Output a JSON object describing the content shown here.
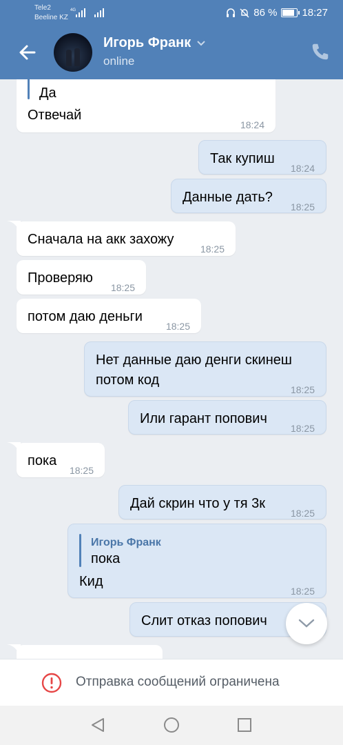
{
  "status": {
    "carrier1": "Tele2",
    "carrier2": "Beeline KZ",
    "network": "4G",
    "battery": "86 %",
    "clock": "18:27"
  },
  "header": {
    "name": "Игорь Франк",
    "status": "online"
  },
  "messages": {
    "m0": {
      "reply_text": "Да",
      "text": "Отвечай",
      "time": "18:24"
    },
    "m1": {
      "text": "Так купиш",
      "time": "18:24"
    },
    "m2": {
      "text": "Данные дать?",
      "time": "18:25"
    },
    "m3": {
      "text": "Сначала на акк захожу",
      "time": "18:25"
    },
    "m4": {
      "text": "Проверяю",
      "time": "18:25"
    },
    "m5": {
      "text": "потом даю деньги",
      "time": "18:25"
    },
    "m6": {
      "line1": "Нет данные даю денги скинеш",
      "line2": "потом код",
      "time": "18:25"
    },
    "m7": {
      "text": "Или гарант попович",
      "time": "18:25"
    },
    "m8": {
      "text": "пока",
      "time": "18:25"
    },
    "m9": {
      "text": "Дай скрин что у тя 3к",
      "time": "18:25"
    },
    "m10": {
      "reply_name": "Игорь Франк",
      "reply_text": "пока",
      "text": "Кид",
      "time": "18:25"
    },
    "m11": {
      "text": "Слит отказ попович"
    }
  },
  "restriction": {
    "text": "Отправка сообщений ограничена"
  },
  "colors": {
    "header": "#5181b8",
    "outgoing_bubble": "#dbe7f5",
    "background": "#ebeef2"
  }
}
